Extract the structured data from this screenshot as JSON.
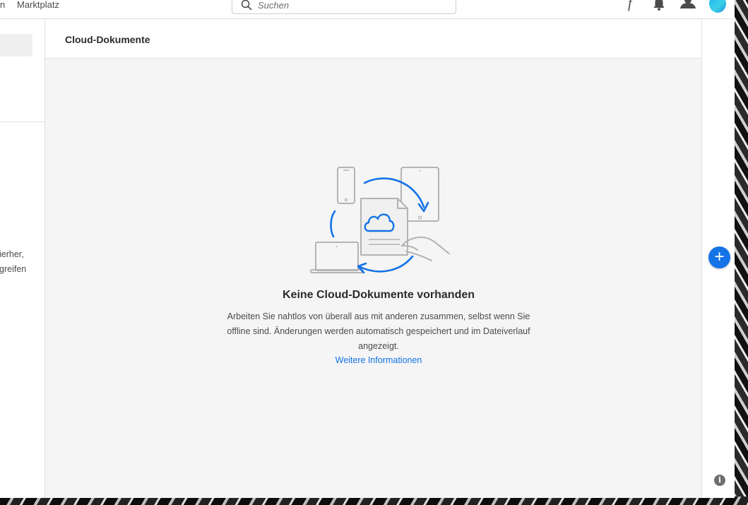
{
  "topbar": {
    "nav_cut_label": "n",
    "nav_marketplace_label": "Marktplatz",
    "search_placeholder": "Suchen"
  },
  "left": {
    "text_lines": [
      "ierher,",
      "greifen"
    ]
  },
  "main": {
    "title": "Cloud-Dokumente",
    "empty_title": "Keine Cloud-Dokumente vorhanden",
    "empty_desc": "Arbeiten Sie nahtlos von überall aus mit anderen zusammen, selbst wenn Sie offline sind. Änderungen werden automatisch gespeichert und im Dateiverlauf angezeigt.",
    "more_link": "Weitere Informationen"
  },
  "rightrail": {
    "add_label": "+",
    "info_label": "i"
  },
  "colors": {
    "accent": "#1473e6",
    "background": "#f5f5f5",
    "illustration_gray": "#b3b3b3"
  },
  "icons": [
    "search-icon",
    "font-icon",
    "bell-icon",
    "user-icon",
    "avatar",
    "plus-icon",
    "info-icon",
    "cloud-sync-illustration"
  ]
}
